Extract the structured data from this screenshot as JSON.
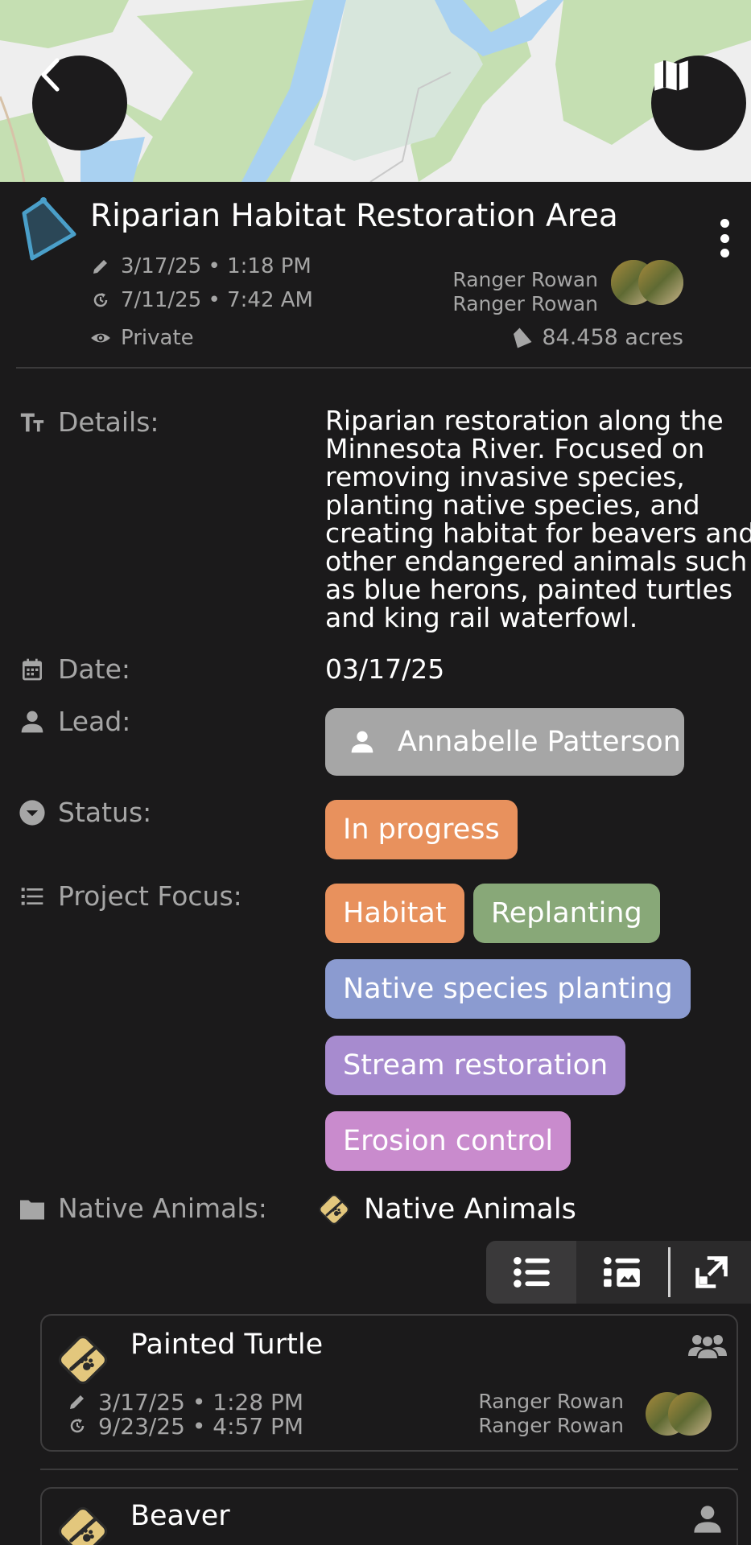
{
  "header": {
    "title": "Riparian Habitat Restoration Area",
    "edited": "3/17/25 • 1:18 PM",
    "updated": "7/11/25 • 7:42 AM",
    "visibility": "Private",
    "owner_1": "Ranger Rowan",
    "owner_2": "Ranger Rowan",
    "area": "84.458 acres"
  },
  "fields": {
    "details_label": "Details:",
    "details_lines": [
      "Riparian restoration along the",
      "Minnesota River. Focused on",
      "removing invasive species,",
      "planting native species, and",
      "creating habitat for beavers and",
      "other endangered animals such",
      "as blue herons, painted turtles",
      "and king rail waterfowl."
    ],
    "date_label": "Date:",
    "date_value": "03/17/25",
    "lead_label": "Lead:",
    "lead_value": "Annabelle Patterson",
    "status_label": "Status:",
    "status_value": "In progress",
    "focus_label": "Project Focus:",
    "focus_tags": [
      "Habitat",
      "Replanting",
      "Native species planting",
      "Stream restoration",
      "Erosion control"
    ],
    "animals_label": "Native Animals:",
    "animals_link": "Native Animals"
  },
  "colors": {
    "habitat": "#e8915d",
    "replanting": "#88a878",
    "native_species": "#8b9bd0",
    "stream": "#a78bcf",
    "erosion": "#c98bcd",
    "status": "#e8915d",
    "lead_chip": "#a6a6a6",
    "area_icon": "#4a9fc9",
    "animal_icon": "#e3c77d"
  },
  "cards": [
    {
      "title": "Painted Turtle",
      "edited": "3/17/25 • 1:28 PM",
      "updated": "9/23/25 • 4:57 PM",
      "owner_1": "Ranger Rowan",
      "owner_2": "Ranger Rowan",
      "group_icon": "group-icon"
    },
    {
      "title": "Beaver",
      "group_icon": "person-icon"
    }
  ]
}
